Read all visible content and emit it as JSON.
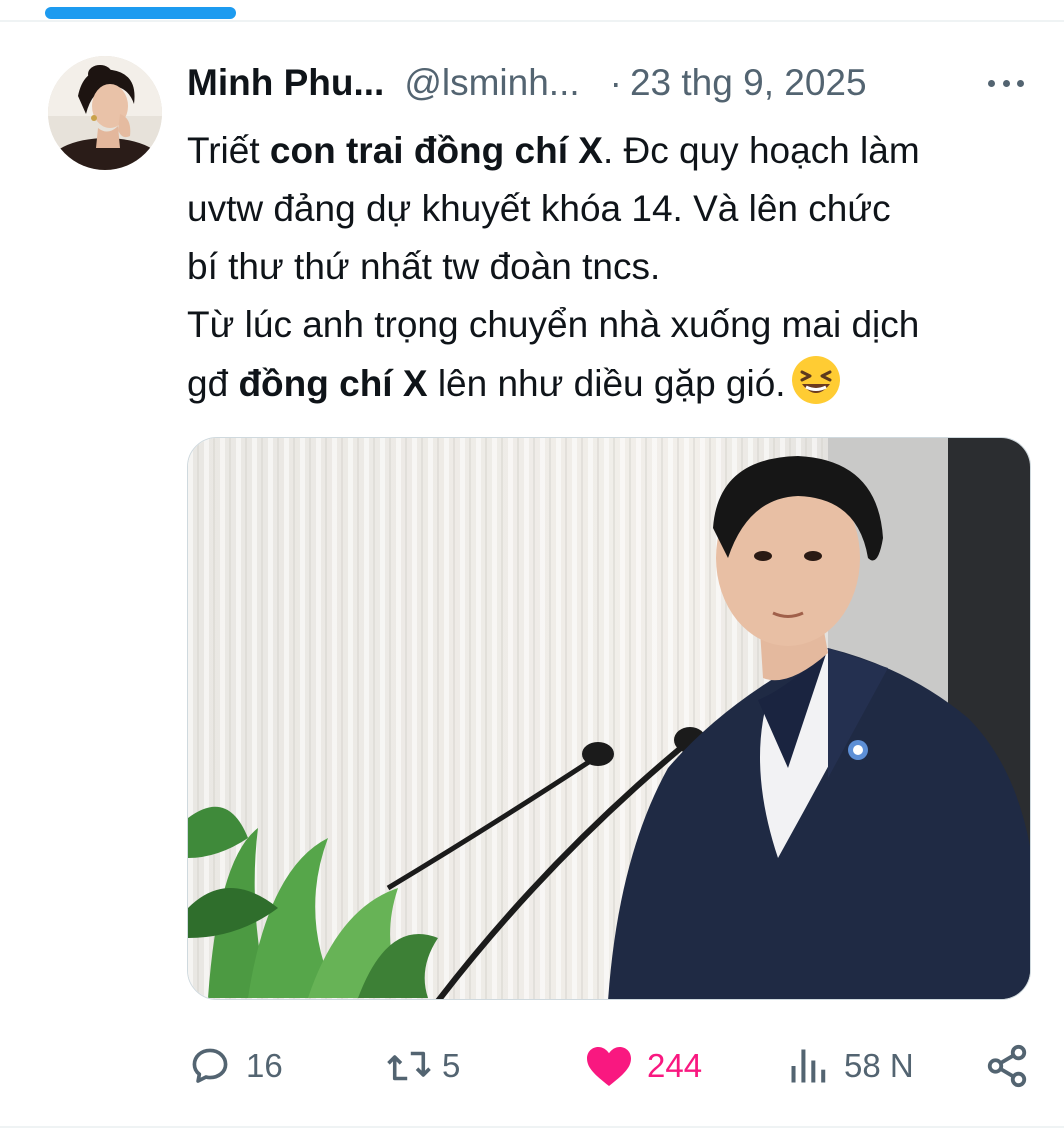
{
  "author": {
    "display_name": "Minh Phu...",
    "handle": "@lsminh...",
    "separator": "·",
    "date": "23 thg 9, 2025"
  },
  "tweet": {
    "line1_a": "Triết ",
    "line1_b": "con trai đồng chí X",
    "line1_c": ". Đc quy hoạch làm",
    "line2": "uvtw đảng dự khuyết khóa 14. Và lên chức",
    "line3": "bí thư thứ nhất tw đoàn tncs.",
    "line4": "Từ lúc anh trọng chuyển nhà xuống mai dịch",
    "line5_a": "gđ ",
    "line5_b": "đồng chí X",
    "line5_c": " lên như diều gặp gió."
  },
  "actions": {
    "replies": "16",
    "reposts": "5",
    "likes": "244",
    "views": "58 N"
  },
  "colors": {
    "accent": "#1d9bf0",
    "like": "#f91880",
    "muted": "#536471"
  },
  "icons": [
    "more-icon",
    "reply-icon",
    "repost-icon",
    "heart-icon",
    "views-icon",
    "share-icon",
    "laughing-emoji-icon"
  ]
}
